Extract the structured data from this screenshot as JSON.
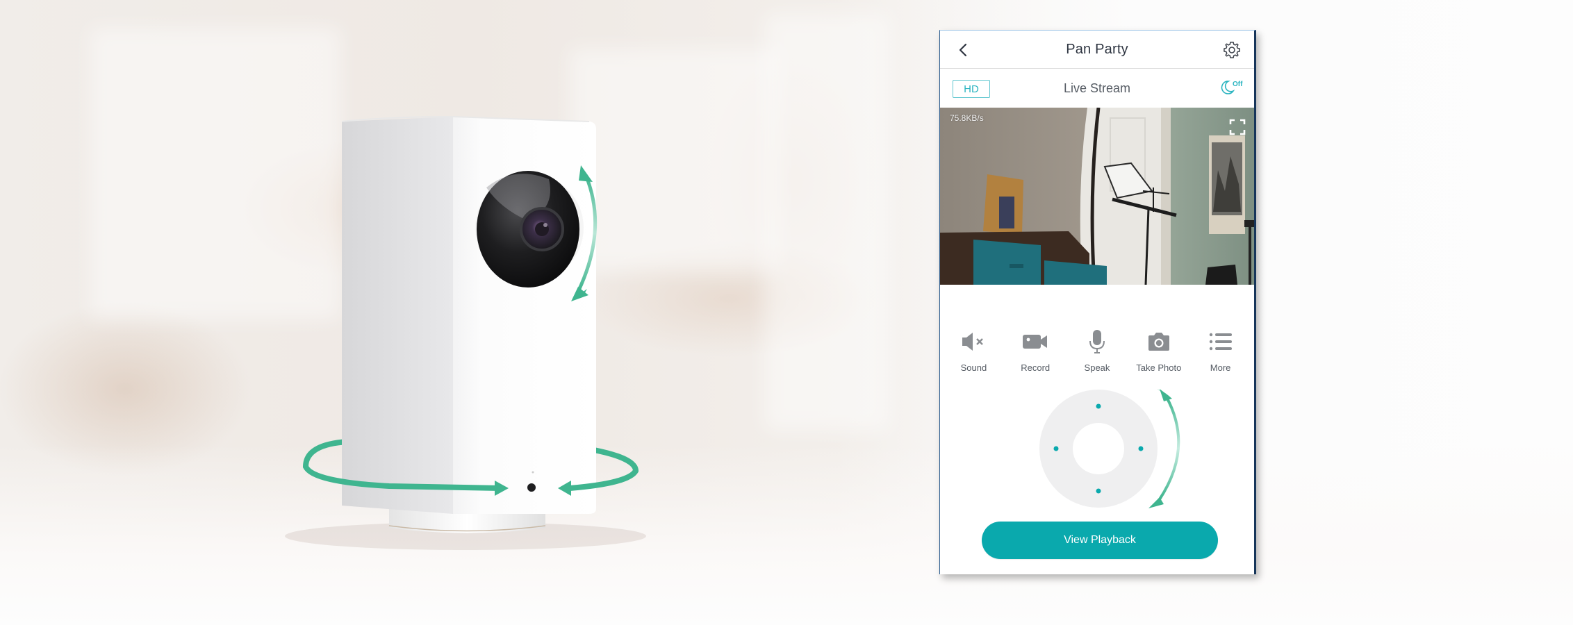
{
  "header": {
    "title": "Pan Party",
    "back_icon": "chevron-left-icon",
    "settings_icon": "gear-icon"
  },
  "stream_bar": {
    "quality_label": "HD",
    "title": "Live Stream",
    "night_vision_icon": "moon-icon",
    "night_vision_state": "Off"
  },
  "video": {
    "bitrate": "75.8KB/s",
    "fullscreen_icon": "fullscreen-icon"
  },
  "controls": [
    {
      "label": "Sound",
      "icon": "speaker-muted-icon"
    },
    {
      "label": "Record",
      "icon": "video-camera-icon"
    },
    {
      "label": "Speak",
      "icon": "microphone-icon"
    },
    {
      "label": "Take Photo",
      "icon": "camera-icon"
    },
    {
      "label": "More",
      "icon": "list-icon"
    }
  ],
  "pan_tilt": {
    "directions": [
      "up",
      "down",
      "left",
      "right"
    ]
  },
  "playback_button": {
    "label": "View Playback"
  },
  "colors": {
    "accent": "#0aa9ad",
    "accent_light": "#2ab4c0",
    "arrow_green": "#3fb58f",
    "text_dark": "#2d3440",
    "text_muted": "#555b63",
    "icon_gray": "#8a8d91",
    "dpad_bg": "#efefef"
  }
}
